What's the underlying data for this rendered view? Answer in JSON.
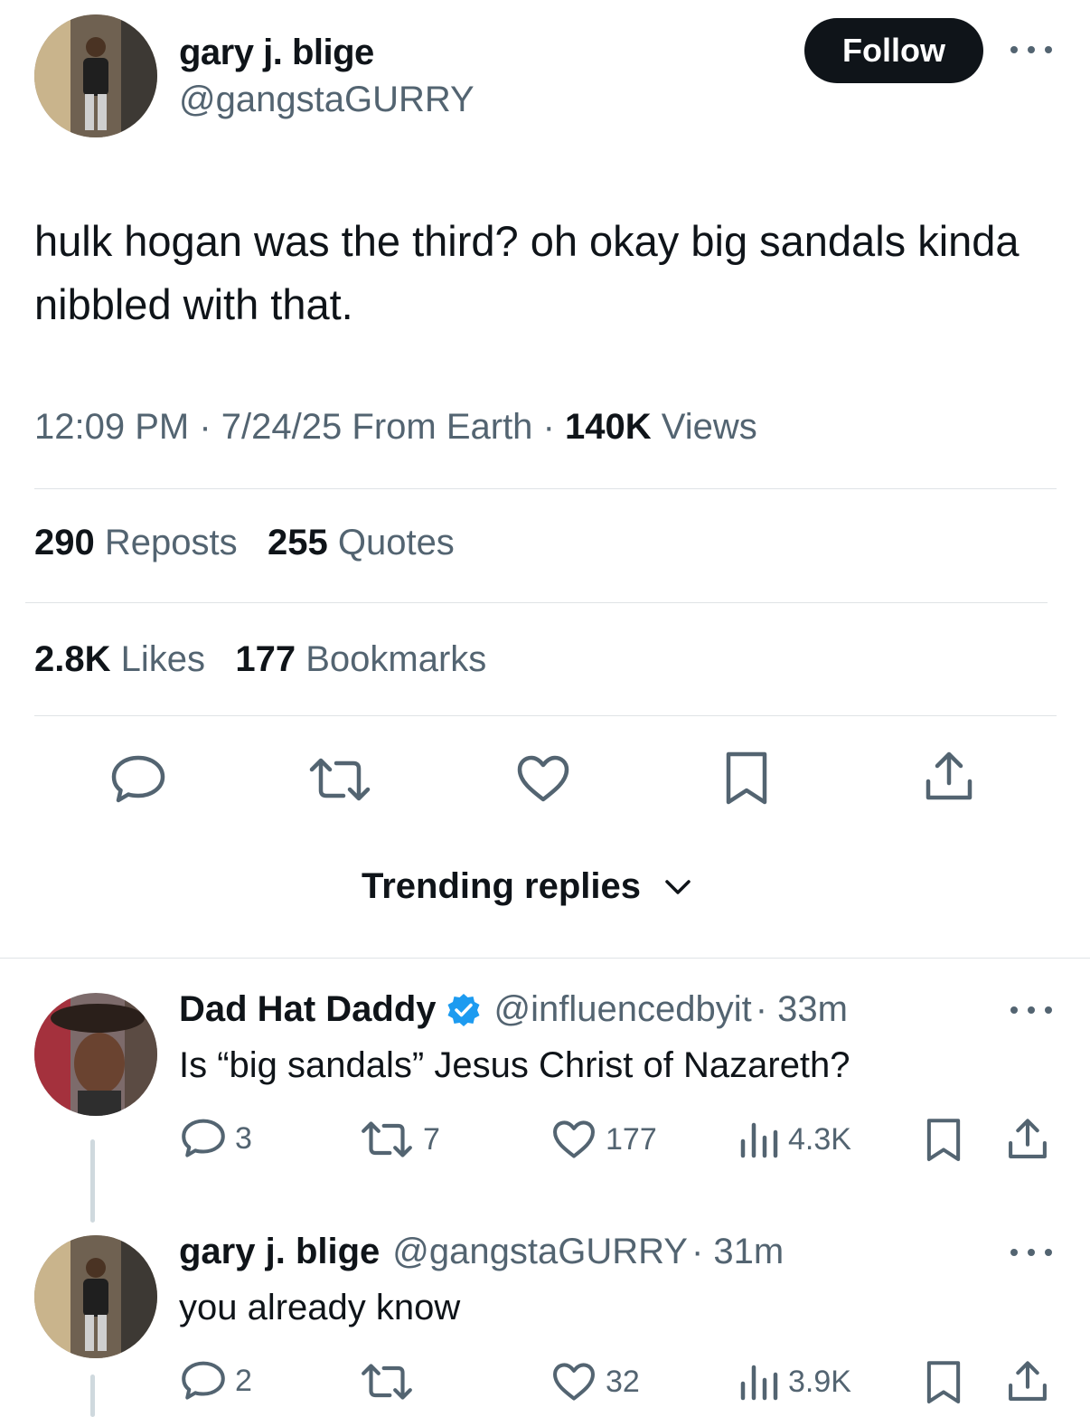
{
  "tweet": {
    "author_name": "gary j. blige",
    "author_handle": "@gangstaGURRY",
    "follow_label": "Follow",
    "text": "hulk hogan was the third? oh okay big sandals kinda nibbled with that.",
    "time": "12:09 PM",
    "date": "7/24/25",
    "source": "From Earth",
    "views_count": "140K",
    "views_label": "Views",
    "separator": "·",
    "reposts_count": "290",
    "reposts_label": "Reposts",
    "quotes_count": "255",
    "quotes_label": "Quotes",
    "likes_count": "2.8K",
    "likes_label": "Likes",
    "bookmarks_count": "177",
    "bookmarks_label": "Bookmarks"
  },
  "trending": {
    "label": "Trending replies"
  },
  "replies": [
    {
      "name": "Dad Hat Daddy",
      "verified": true,
      "handle": "@influencedbyit",
      "time": "· 33m",
      "text": "Is “big sandals” Jesus Christ of Nazareth?",
      "reply_count": "3",
      "repost_count": "7",
      "like_count": "177",
      "views_count": "4.3K"
    },
    {
      "name": "gary j. blige",
      "verified": false,
      "handle": "@gangstaGURRY",
      "time": "· 31m",
      "text": "you already know",
      "reply_count": "2",
      "repost_count": "",
      "like_count": "32",
      "views_count": "3.9K"
    }
  ],
  "colors": {
    "text": "#0f1419",
    "secondary": "#536471",
    "verified": "#1d9bf0",
    "divider": "#dfe3e6"
  },
  "icons": [
    "reply-icon",
    "repost-icon",
    "like-icon",
    "bookmark-icon",
    "share-icon",
    "views-icon",
    "verified-badge-icon",
    "more-icon",
    "chevron-down-icon"
  ]
}
